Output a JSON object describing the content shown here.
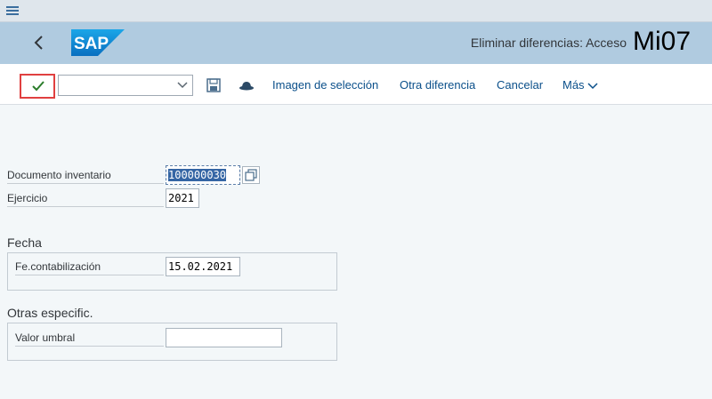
{
  "shell": {
    "title": "Eliminar diferencias: Acceso",
    "tcode": "Mi07",
    "logo_text": "SAP"
  },
  "toolbar": {
    "command_value": "",
    "buttons": [
      "Imagen de selección",
      "Otra diferencia",
      "Cancelar",
      "Más"
    ]
  },
  "form": {
    "doc_label": "Documento inventario",
    "doc_value": "100000030",
    "year_label": "Ejercicio",
    "year_value": "2021",
    "fecha_title": "Fecha",
    "posting_label": "Fe.contabilización",
    "posting_value": "15.02.2021",
    "otras_title": "Otras especific.",
    "threshold_label": "Valor umbral",
    "threshold_value": ""
  },
  "colors": {
    "shellbar": "#b0cbe0",
    "link": "#0a4f8a",
    "highlight": "#e04040",
    "selection": "#3465a4"
  }
}
